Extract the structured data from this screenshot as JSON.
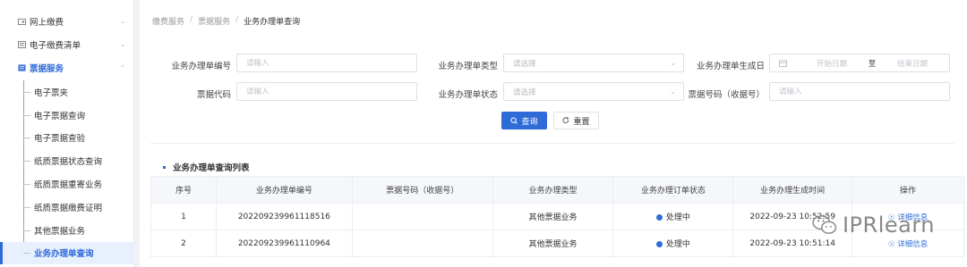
{
  "sidebar": {
    "groups": [
      {
        "label": "网上缴费",
        "icon": "wallet-icon"
      },
      {
        "label": "电子缴费清单",
        "icon": "list-icon"
      },
      {
        "label": "票据服务",
        "icon": "ticket-icon"
      }
    ],
    "items": [
      {
        "label": "电子票夹"
      },
      {
        "label": "电子票据查询"
      },
      {
        "label": "电子票据查验"
      },
      {
        "label": "纸质票据状态查询"
      },
      {
        "label": "纸质票据重寄业务"
      },
      {
        "label": "纸质票据缴费证明"
      },
      {
        "label": "其他票据业务"
      },
      {
        "label": "业务办理单查询"
      }
    ]
  },
  "breadcrumb": {
    "items": [
      "缴费服务",
      "票据服务",
      "业务办理单查询"
    ],
    "sep": "/"
  },
  "form": {
    "order_no_label": "业务办理单编号",
    "order_no_placeholder": "请输入",
    "order_type_label": "业务办理单类型",
    "order_type_placeholder": "请选择",
    "created_date_label": "业务办理单生成日",
    "start_date_placeholder": "开始日期",
    "date_to": "至",
    "end_date_placeholder": "结束日期",
    "ticket_code_label": "票据代码",
    "ticket_code_placeholder": "请输入",
    "order_status_label": "业务办理单状态",
    "order_status_placeholder": "请选择",
    "ticket_no_label": "票据号码（收据号）",
    "ticket_no_placeholder": "请输入"
  },
  "buttons": {
    "search": "查询",
    "reset": "重置"
  },
  "section": {
    "title": "业务办理单查询列表"
  },
  "table": {
    "headers": [
      "序号",
      "业务办理单编号",
      "票据号码（收据号）",
      "业务办理类型",
      "业务办理订单状态",
      "业务办理生成时间",
      "操作"
    ],
    "rows": [
      {
        "index": "1",
        "order_no": "202209239961118516",
        "ticket_no": "",
        "type": "其他票据业务",
        "status": "处理中",
        "time": "2022-09-23 10:52:59",
        "action": "详细信息"
      },
      {
        "index": "2",
        "order_no": "202209239961110964",
        "ticket_no": "",
        "type": "其他票据业务",
        "status": "处理中",
        "time": "2022-09-23 10:51:14",
        "action": "详细信息"
      }
    ]
  },
  "watermark": {
    "text": "IPRlearn"
  },
  "colors": {
    "accent": "#2f6bd8",
    "active_bg": "#e8f0fe"
  }
}
